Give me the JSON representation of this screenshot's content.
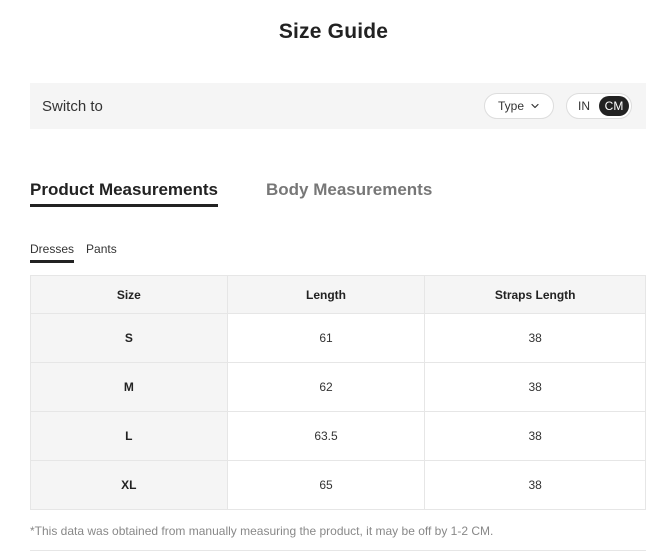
{
  "title": "Size Guide",
  "switch": {
    "label": "Switch to",
    "type_label": "Type",
    "units": [
      "IN",
      "CM"
    ],
    "active_unit": "CM"
  },
  "main_tabs": [
    {
      "label": "Product Measurements",
      "active": true
    },
    {
      "label": "Body Measurements",
      "active": false
    }
  ],
  "sub_tabs": [
    {
      "label": "Dresses",
      "active": true
    },
    {
      "label": "Pants",
      "active": false
    }
  ],
  "table": {
    "headers": [
      "Size",
      "Length",
      "Straps Length"
    ],
    "rows": [
      [
        "S",
        "61",
        "38"
      ],
      [
        "M",
        "62",
        "38"
      ],
      [
        "L",
        "63.5",
        "38"
      ],
      [
        "XL",
        "65",
        "38"
      ]
    ]
  },
  "note": "*This data was obtained from manually measuring the product, it may be off by 1-2 CM.",
  "colors": {
    "accent": "#222222",
    "panel_bg": "#f5f5f5",
    "border": "#e6e6e6",
    "muted_text": "#777777"
  },
  "icons": {
    "type_select": "chevron-down-icon"
  }
}
